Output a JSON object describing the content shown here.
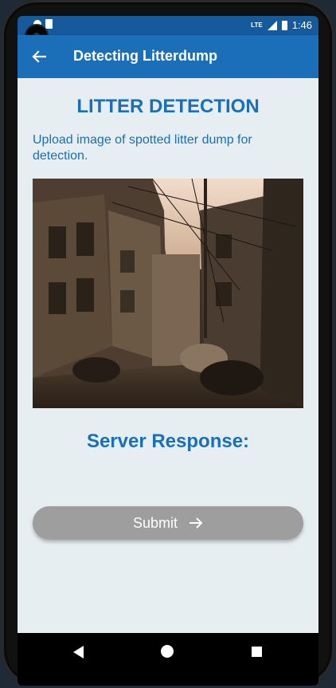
{
  "status_bar": {
    "network": "LTE",
    "time": "1:46"
  },
  "app_bar": {
    "title": "Detecting Litterdump",
    "back_icon": "arrow-left-icon"
  },
  "main": {
    "heading": "LITTER DETECTION",
    "instruction": "Upload image of spotted litter dump for detection.",
    "response_label": "Server Response:",
    "submit_label": "Submit",
    "submit_icon": "arrow-right-icon"
  },
  "nav_bar": {
    "icons": [
      "back-triangle-icon",
      "home-circle-icon",
      "recents-square-icon"
    ]
  },
  "colors": {
    "primary": "#1a6fb8",
    "status_bar": "#175a9c",
    "background": "#e6eef2",
    "button_disabled": "#9e9e9e"
  }
}
